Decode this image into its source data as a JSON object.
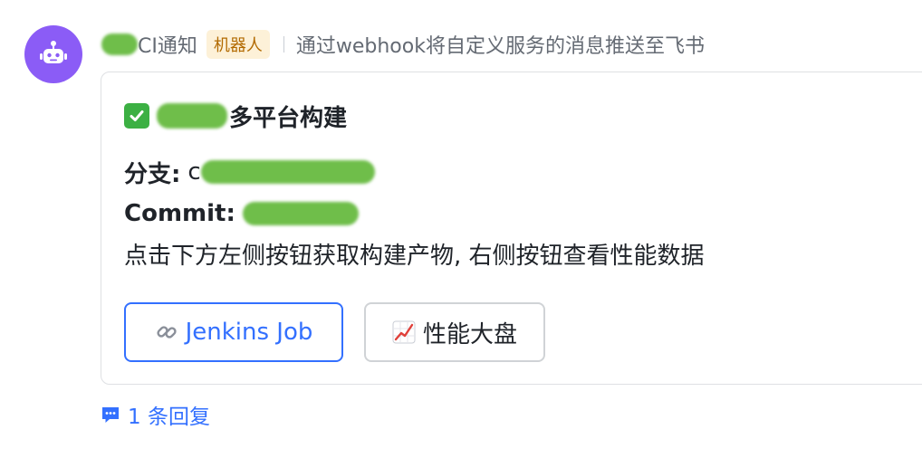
{
  "message": {
    "sender": {
      "name_visible": "CI通知",
      "badge": "机器人",
      "description": "通过webhook将自定义服务的消息推送至飞书"
    },
    "avatar": {
      "icon": "robot-icon",
      "color": "#8b5cf6"
    },
    "card": {
      "title_icon": "check-mark-icon",
      "title_text": "多平台构建",
      "branch_label": "分支:",
      "branch_value_prefix": "c",
      "commit_label": "Commit:",
      "description": "点击下方左侧按钮获取构建产物, 右侧按钮查看性能数据",
      "buttons": [
        {
          "icon": "link-icon",
          "label": "Jenkins Job",
          "style": "primary"
        },
        {
          "icon": "chart-increasing-icon",
          "label": "性能大盘",
          "style": "default"
        }
      ]
    },
    "reply": {
      "icon": "comment-icon",
      "label": "1 条回复"
    }
  },
  "colors": {
    "accent": "#3370ff",
    "redaction": "#6fbe4a",
    "badge_bg": "#fdf1d8",
    "badge_text": "#b26a00"
  }
}
